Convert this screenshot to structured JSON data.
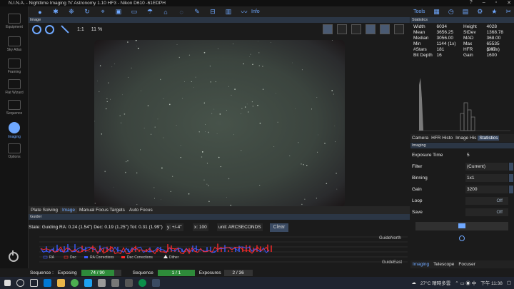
{
  "app": {
    "title": "N.I.N.A. - Nighttime Imaging 'N' Astronomy 1.10 HF3   -   Nikon D610 -61EDPH"
  },
  "toolbar": {
    "info_label": "Info",
    "tools_label": "Tools"
  },
  "sidebar": {
    "items": [
      {
        "label": "Equipment"
      },
      {
        "label": "Sky Atlas"
      },
      {
        "label": "Framing"
      },
      {
        "label": "Flat Wizard"
      },
      {
        "label": "Sequence"
      },
      {
        "label": "Imaging"
      },
      {
        "label": "Options"
      }
    ]
  },
  "image_panel": {
    "header": "Image",
    "zoom_reset": "1:1",
    "zoom_level": "11 %",
    "tabs": [
      "Plate Solving",
      "Image",
      "Manual Focus Targets",
      "Auto Focus"
    ]
  },
  "statistics": {
    "header": "Statistics",
    "rows": [
      {
        "k1": "Width",
        "v1": "6034",
        "k2": "Height",
        "v2": "4028"
      },
      {
        "k1": "Mean",
        "v1": "3656.25",
        "k2": "StDev",
        "v2": "1368.78"
      },
      {
        "k1": "Median",
        "v1": "3056.00",
        "k2": "MAD",
        "v2": "368.00"
      },
      {
        "k1": "Min",
        "v1": "1144 (1x)",
        "k2": "Max",
        "v2": "65535 (203x)"
      },
      {
        "k1": "#Stars",
        "v1": "181",
        "k2": "HFR",
        "v2": "3.47"
      },
      {
        "k1": "Bit Depth",
        "v1": "16",
        "k2": "Gain",
        "v2": "1600"
      }
    ],
    "tabs": [
      "Camera",
      "HFR Histo",
      "Image His",
      "Statistics"
    ]
  },
  "imaging": {
    "header": "Imaging",
    "fields": [
      {
        "label": "Exposure Time",
        "value": "5"
      },
      {
        "label": "Filter",
        "value": "(Current)"
      },
      {
        "label": "Binning",
        "value": "1x1"
      },
      {
        "label": "Gain",
        "value": "3200"
      },
      {
        "label": "Loop",
        "value": "Off"
      },
      {
        "label": "Save",
        "value": "Off"
      }
    ],
    "tabs": [
      "Imaging",
      "Telescope",
      "Focuser"
    ]
  },
  "guider": {
    "header": "Guider",
    "state": "State: Guiding  RA: 0.24 (1.54\")  Dec: 0.19 (1.25\")  Tot: 0.31 (1.99\")",
    "y_scale": "y: +/-4\"",
    "x_scale": "x: 100",
    "unit": "unit: ARCSECONDS",
    "clear_label": "Clear",
    "north_label": "GuideNorth",
    "east_label": "GuideEast",
    "legend": [
      "RA",
      "Dec",
      "RA Corrections",
      "Dec Corrections",
      "Dither"
    ],
    "colors": {
      "ra": "#3a5bff",
      "dec": "#ff2a2a"
    }
  },
  "status": {
    "sequence_label": "Sequence :",
    "exposing_label": "Exposing",
    "exposing_progress": "74 / 90",
    "exposing_fraction": 0.822,
    "sequence2_label": "Sequence",
    "sequence_progress": "1 / 1",
    "exposures_label": "Exposures",
    "exposures_progress": "2 / 36"
  },
  "taskbar": {
    "weather": "27°C  晴時多雲",
    "time": "下午 11:38"
  },
  "colors": {
    "accent": "#6fa8ff",
    "progress": "#2e8b3a",
    "panel_header": "#2b3645"
  }
}
